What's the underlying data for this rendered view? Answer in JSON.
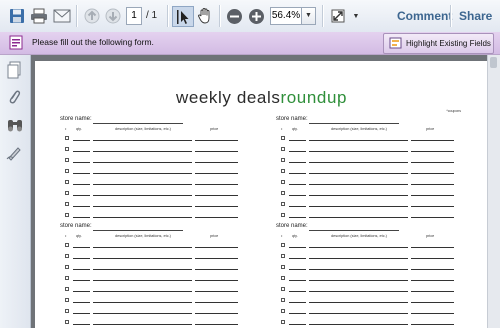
{
  "toolbar": {
    "current_page": "1",
    "page_total": "/ 1",
    "zoom": "56.4%",
    "comment_label": "Comment",
    "share_label": "Share"
  },
  "formbar": {
    "message": "Please fill out the following form.",
    "highlight_label": "Highlight Existing Fields"
  },
  "document": {
    "title_part1": "weekly deals",
    "title_part2": "roundup",
    "subtitle": "*coupons",
    "title_accent_color": "#2f8f3a",
    "sections": [
      {
        "store_label": "store  name:",
        "col_qty": "qty.",
        "col_desc": "description (size, limitations, etc.)",
        "col_price": "price",
        "rows": 8
      },
      {
        "store_label": "store  name:",
        "col_qty": "qty.",
        "col_desc": "description (size, limitations, etc.)",
        "col_price": "price",
        "rows": 8
      },
      {
        "store_label": "store  name:",
        "col_qty": "qty.",
        "col_desc": "description (size, limitations, etc.)",
        "col_price": "price",
        "rows": 8
      },
      {
        "store_label": "store  name:",
        "col_qty": "qty.",
        "col_desc": "description (size, limitations, etc.)",
        "col_price": "price",
        "rows": 8
      }
    ]
  },
  "colors": {
    "formbar_bg": "#dcc7ea",
    "link_color": "#3d6690",
    "doc_bg": "#6f7378"
  }
}
